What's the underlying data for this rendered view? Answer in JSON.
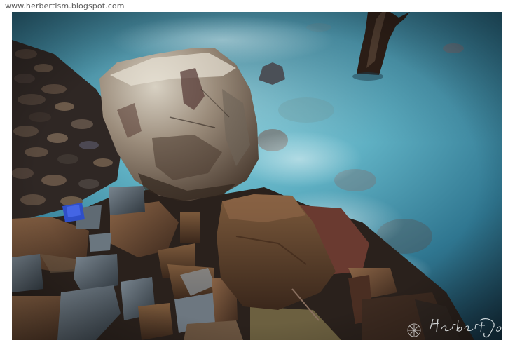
{
  "page": {
    "source_url": "www.herbertism.blogspot.com"
  },
  "photo": {
    "subject": "long-exposure seascape",
    "colors": {
      "water_light": "#8fd2e0",
      "water_mid": "#3f8ea5",
      "water_dark": "#183c4e",
      "rock_brown": "#6b4a32",
      "rock_grey": "#5c6770",
      "boulder_light": "#c9c2b4",
      "frame": "#ffffff"
    },
    "signature": "Herbert Johan"
  }
}
